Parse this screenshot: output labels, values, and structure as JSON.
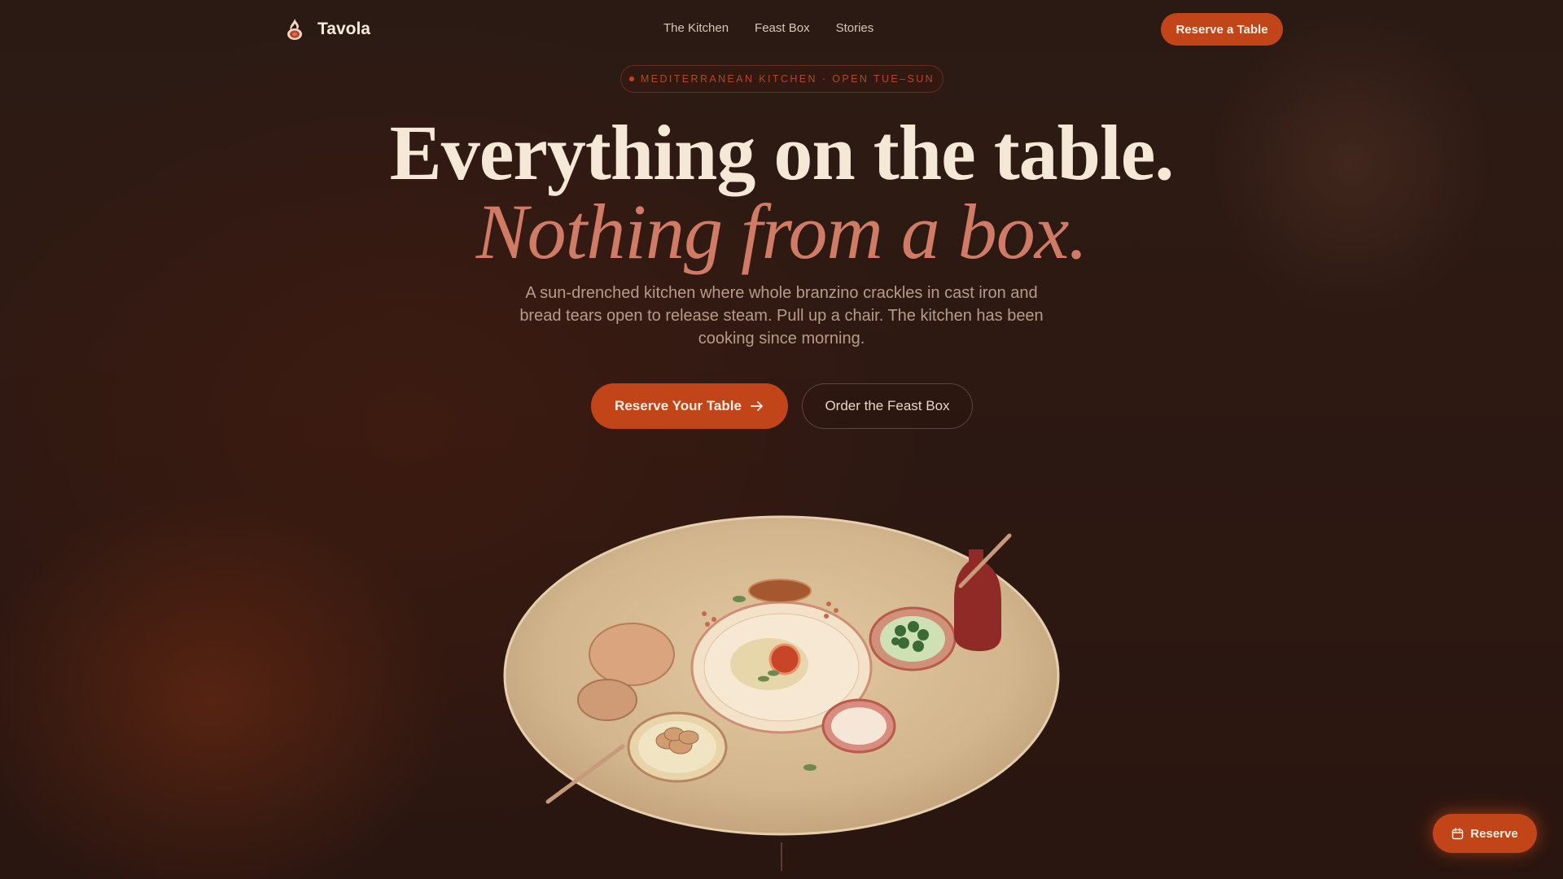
{
  "brand": {
    "name": "Tavola",
    "logo_icon": "flame-pot-icon"
  },
  "nav": {
    "links": [
      "The Kitchen",
      "Feast Box",
      "Stories"
    ],
    "cta_label": "Reserve a Table"
  },
  "hero": {
    "badge_text": "MEDITERRANEAN KITCHEN · OPEN TUE–SUN",
    "headline_line1": "Everything on the table.",
    "headline_line2": "Nothing from a box.",
    "lead": "A sun-drenched kitchen where whole branzino crackles in cast iron and bread tears open to release steam. Pull up a chair. The kitchen has been cooking since morning.",
    "primary_cta": "Reserve Your Table",
    "primary_cta_icon": "arrow-right-icon",
    "secondary_cta": "Order the Feast Box"
  },
  "floating_button": {
    "label": "Reserve",
    "icon": "calendar-icon"
  },
  "colors": {
    "accent": "#c2451a",
    "background": "#2a1812",
    "headline": "#f6e8d6",
    "headline_italic": "#d07b66"
  }
}
